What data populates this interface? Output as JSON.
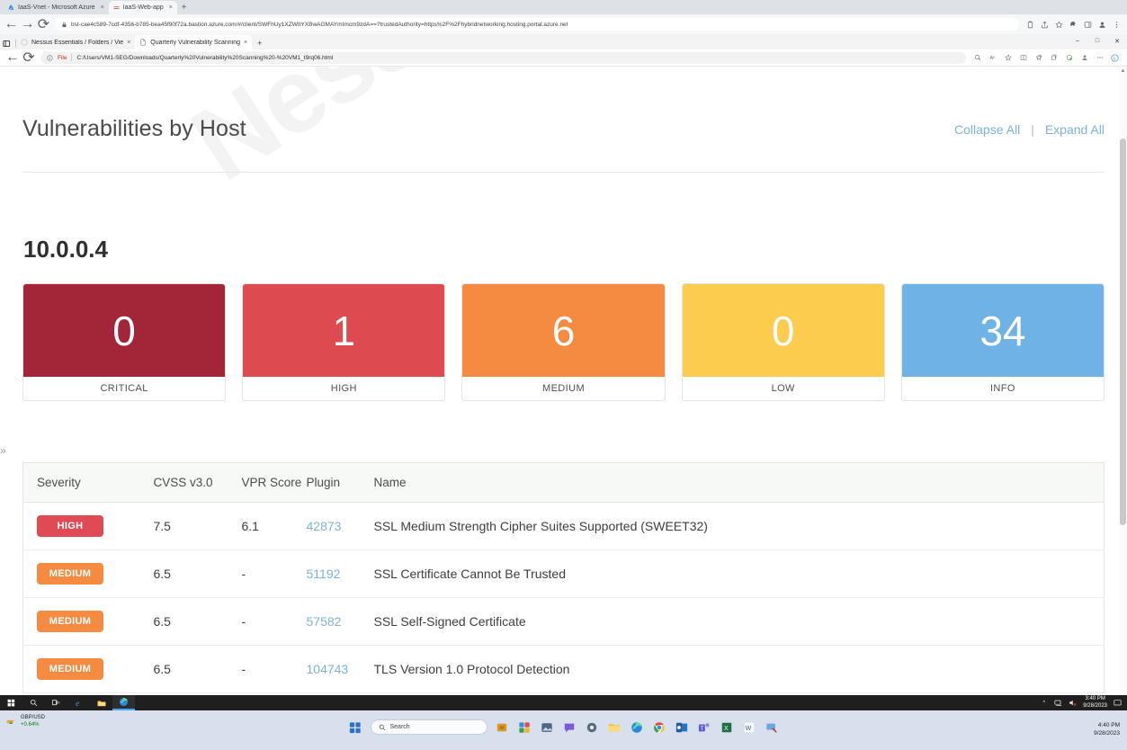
{
  "outer_browser": {
    "tabs": [
      {
        "label": "IaaS-Vnet - Microsoft Azure",
        "favicon": "azure-icon",
        "active": false,
        "close": "×"
      },
      {
        "label": "IaaS-Web-app",
        "favicon": "bastion-icon",
        "active": true,
        "close": "×"
      }
    ],
    "new_tab_label": "+",
    "back_icon": "←",
    "forward_icon": "→",
    "reload_icon": "⟳",
    "lock_icon": "lock-icon",
    "url": "bst-cae4c589-7cdf-4356-b785-bea45f90f72a.bastion.azure.com/#/client/SWFhUy1XZWItYXBwAGMAYmImcm9zdA==?trustedAuthority=https%2F%2Fhybridnetworking.hosting.portal.azure.net",
    "toolbar_icons": [
      "clipboard-icon",
      "share-icon",
      "bookmark-star-icon",
      "extensions-puzzle-icon",
      "sidepanel-icon",
      "profile-avatar-icon",
      "more-vertical-icon"
    ]
  },
  "inner_browser": {
    "tabs": [
      {
        "label": "Nessus Essentials / Folders / Vie",
        "favicon": "nessus-icon",
        "active": false,
        "close": "×"
      },
      {
        "label": "Quarterly Vulnerability Scanning",
        "favicon": "document-icon",
        "active": true,
        "close": "×"
      }
    ],
    "new_tab_label": "+",
    "tab_actions_icon": "tab-actions-icon",
    "window_controls": {
      "minimize": "–",
      "maximize": "□",
      "close": "✕"
    },
    "back_icon": "←",
    "reload_icon": "⟳",
    "info_icon": "info-circle-icon",
    "file_label": "File",
    "path": "C:/Users/VM1-SEG/Downloads/Quarterly%20Vulnerability%20Scanning%20-%20VM1_t9rq06.html",
    "toolbar_icons": [
      "zoom-icon",
      "read-aloud-icon",
      "favorite-star-icon",
      "split-screen-icon",
      "add-favorite-icon",
      "collections-icon",
      "browser-essentials-icon",
      "profile-avatar-icon",
      "more-horizontal-icon",
      "copilot-icon"
    ]
  },
  "report": {
    "watermark": "Nessus Essentials",
    "section_title": "Vulnerabilities by Host",
    "collapse_all": "Collapse All",
    "separator": "|",
    "expand_all": "Expand All",
    "host": "10.0.0.4",
    "severity_cards": [
      {
        "count": "0",
        "label": "CRITICAL",
        "color": "#a32638"
      },
      {
        "count": "1",
        "label": "HIGH",
        "color": "#dd4b50"
      },
      {
        "count": "6",
        "label": "MEDIUM",
        "color": "#f58b41"
      },
      {
        "count": "0",
        "label": "LOW",
        "color": "#fbcc4d"
      },
      {
        "count": "34",
        "label": "INFO",
        "color": "#6fb2e5"
      }
    ],
    "table": {
      "columns": [
        "Severity",
        "CVSS v3.0",
        "VPR Score",
        "Plugin",
        "Name"
      ],
      "rows": [
        {
          "severity": "HIGH",
          "severity_color": "#e04a54",
          "cvss": "7.5",
          "vpr": "6.1",
          "plugin": "42873",
          "name": "SSL Medium Strength Cipher Suites Supported (SWEET32)"
        },
        {
          "severity": "MEDIUM",
          "severity_color": "#f58b41",
          "cvss": "6.5",
          "vpr": "-",
          "plugin": "51192",
          "name": "SSL Certificate Cannot Be Trusted"
        },
        {
          "severity": "MEDIUM",
          "severity_color": "#f58b41",
          "cvss": "6.5",
          "vpr": "-",
          "plugin": "57582",
          "name": "SSL Self-Signed Certificate"
        },
        {
          "severity": "MEDIUM",
          "severity_color": "#f58b41",
          "cvss": "6.5",
          "vpr": "-",
          "plugin": "104743",
          "name": "TLS Version 1.0 Protocol Detection"
        }
      ]
    },
    "bastion_expander": "»"
  },
  "vm_taskbar": {
    "buttons": [
      "windows-start-icon",
      "search-icon",
      "task-view-icon",
      "internet-explorer-icon",
      "file-explorer-icon",
      "edge-icon"
    ],
    "tray_icons": [
      "show-hidden-icons-chevron",
      "network-icon",
      "volume-icon"
    ],
    "time": "3:40 PM",
    "date": "9/28/2023",
    "action_center_icon": "action-center-icon"
  },
  "host_taskbar": {
    "widget": {
      "ticker": "GBP/USD",
      "change": "+0.64%"
    },
    "start_icon": "windows-start-icon",
    "search_placeholder": "Search",
    "pinned_apps": [
      "copilot-icon",
      "widgets-icon",
      "photos-icon",
      "file-explorer-icon",
      "teams-chat-icon",
      "settings-icon",
      "explorer-folder-icon",
      "edge-icon",
      "chrome-icon",
      "outlook-icon",
      "teams-icon",
      "excel-icon",
      "word-icon",
      "remote-desktop-icon"
    ],
    "time": "4:40 PM",
    "date": "9/28/2023"
  }
}
